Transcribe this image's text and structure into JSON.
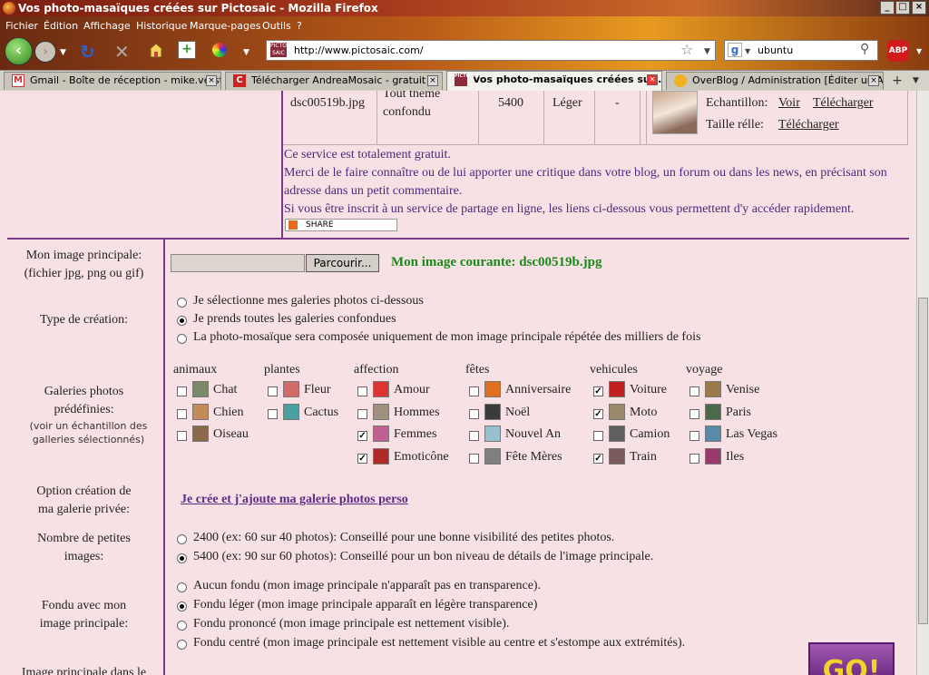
{
  "window": {
    "title": "Vos photo-masaïques créées sur Pictosaic - Mozilla Firefox"
  },
  "menu": [
    "Fichier",
    "Édition",
    "Affichage",
    "Historique",
    "Marque-pages",
    "Outils",
    "?"
  ],
  "url": "http://www.pictosaic.com/",
  "search": "ubuntu",
  "tabs": [
    "Gmail - Boîte de réception - mike.verst...",
    "Télécharger AndreaMosaic - gratuit -",
    "Vos photo-masaïques créées su...",
    "OverBlog / Administration [Éditer un Art..."
  ],
  "table_row": {
    "name": "dsc00519b.jpg",
    "theme": "Tout thème confondu",
    "theme_line1": "Tout thème",
    "theme_line2": "confondu",
    "count": "5400",
    "fondu": "Léger",
    "dash": "-",
    "echantillon_label": "Echantillon:",
    "voir": "Voir",
    "telecharger": "Télécharger",
    "taille_label": "Taille rélle:",
    "telecharger2": "Télécharger"
  },
  "notice": {
    "free": "Ce service est totalement gratuit.",
    "thanks": "Merci de le faire connaître ou de lui apporter une critique dans votre blog, un forum ou dans les news, en précisant son adresse dans un petit commentaire.",
    "thanks1": "Merci de le faire connaître ou de lui apporter une critique dans votre blog, un forum ou dans les news, en précisant son",
    "thanks2": "adresse dans un petit commentaire.",
    "share_info": "Si vous être inscrit à un service de partage en ligne, les liens ci-dessous vous permettent d'y accéder rapidement.",
    "share_button": "SHARE"
  },
  "form": {
    "main_image_label1": "Mon image principale:",
    "main_image_label2": "(fichier jpg, png ou gif)",
    "browse": "Parcourir...",
    "current_image": "Mon image courante: dsc00519b.jpg",
    "type_label": "Type de création:",
    "type_options": [
      "Je sélectionne mes galeries photos ci-dessous",
      "Je prends toutes les galeries confondues",
      "La photo-mosaïque sera composée uniquement de mon image principale répétée des milliers de fois"
    ],
    "type_selected": 1,
    "gal_label1": "Galeries photos",
    "gal_label2": "prédéfinies:",
    "gal_note1": "(voir un échantillon des",
    "gal_note2": "galleries sélectionnés)",
    "categories": [
      {
        "name": "animaux",
        "items": [
          {
            "label": "Chat",
            "checked": false
          },
          {
            "label": "Chien",
            "checked": false
          },
          {
            "label": "Oiseau",
            "checked": false
          }
        ]
      },
      {
        "name": "plantes",
        "items": [
          {
            "label": "Fleur",
            "checked": false
          },
          {
            "label": "Cactus",
            "checked": false
          }
        ]
      },
      {
        "name": "affection",
        "items": [
          {
            "label": "Amour",
            "checked": false
          },
          {
            "label": "Hommes",
            "checked": false
          },
          {
            "label": "Femmes",
            "checked": true
          },
          {
            "label": "Emoticône",
            "checked": true
          }
        ]
      },
      {
        "name": "fêtes",
        "items": [
          {
            "label": "Anniversaire",
            "checked": false
          },
          {
            "label": "Noël",
            "checked": false
          },
          {
            "label": "Nouvel An",
            "checked": false
          },
          {
            "label": "Fête Mères",
            "checked": false
          }
        ]
      },
      {
        "name": "vehicules",
        "items": [
          {
            "label": "Voiture",
            "checked": true
          },
          {
            "label": "Moto",
            "checked": true
          },
          {
            "label": "Camion",
            "checked": false
          },
          {
            "label": "Train",
            "checked": true
          }
        ]
      },
      {
        "name": "voyage",
        "items": [
          {
            "label": "Venise",
            "checked": false
          },
          {
            "label": "Paris",
            "checked": false
          },
          {
            "label": "Las Vegas",
            "checked": false
          },
          {
            "label": "Iles",
            "checked": false
          }
        ]
      }
    ],
    "private_label1": "Option création de",
    "private_label2": "ma galerie privée:",
    "private_link": "Je crée et j'ajoute ma galerie photos perso",
    "count_label1": "Nombre de petites",
    "count_label2": "images:",
    "count_options": [
      "2400 (ex: 60 sur 40 photos): Conseillé pour une bonne visibilité des petites photos.",
      "5400 (ex: 90 sur 60 photos): Conseillé pour un bon niveau de détails de l'image principale."
    ],
    "count_selected": 1,
    "fondu_label1": "Fondu avec mon",
    "fondu_label2": "image principale:",
    "fondu_options": [
      "Aucun fondu (mon image principale n'apparaît pas en transparence).",
      "Fondu léger (mon image principale apparaît en légère transparence)",
      "Fondu prononcé (mon image principale est nettement visible).",
      "Fondu centré (mon image principale est nettement visible au centre et s'estompe aux extrémités)."
    ],
    "fondu_selected": 1,
    "cut_label": "Image principale dans le",
    "go_button": "GO!"
  },
  "colors": {
    "page_bg": "#f8e1e4",
    "divider": "#7a3a8a",
    "link": "#5b2b86",
    "current_image": "#1a8a1a"
  }
}
